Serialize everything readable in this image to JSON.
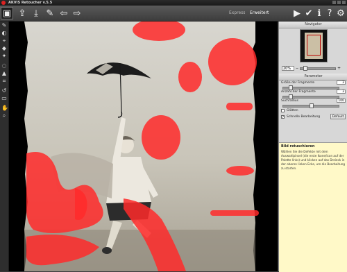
{
  "window": {
    "title": "AKVIS Retoucher v.5.5"
  },
  "toolbar": {
    "mode_express": "Express",
    "mode_advanced": "Erweitert"
  },
  "navigator": {
    "title": "Navigator",
    "zoom": "20%"
  },
  "params": {
    "title": "Parameter",
    "fragment_size_label": "Größe der Fragmente",
    "fragment_size_value": "3",
    "fragment_count_label": "Anzahl der Fragmente",
    "fragment_count_value": "3",
    "search_radius_label": "Suchradius",
    "search_radius_value": "100",
    "smooth_label": "Glätten",
    "fast_label": "Schnelle Bearbeitung",
    "default_button": "Default",
    "fast_checked": "✓"
  },
  "help": {
    "title": "Bild retuschieren",
    "text": "Wählen Sie die Defekte mit dem Auswahlpinsel (die erste Ikone/Icon auf der Palette links) und klicken auf das Dreieck in der oberen linken Ecke, um die Bearbeitung zu starten."
  },
  "colors": {
    "mask": "#ff2a2a",
    "accent": "#d22222"
  }
}
